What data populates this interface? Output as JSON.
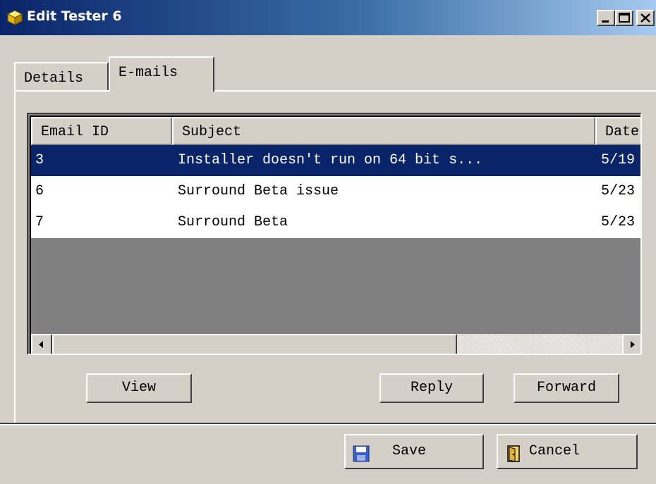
{
  "window": {
    "title": "Edit Tester 6",
    "icon": "yellow-cube-icon",
    "controls": [
      "minimize-icon",
      "maximize-icon",
      "close-icon"
    ]
  },
  "tabs": [
    {
      "label": "Details",
      "active": false
    },
    {
      "label": "E-mails",
      "active": true
    }
  ],
  "email_list": {
    "columns": [
      "Email ID",
      "Subject",
      "Date"
    ],
    "rows": [
      {
        "id": "3",
        "subject": "Installer doesn't run on 64 bit s...",
        "date": "5/19",
        "selected": true
      },
      {
        "id": "6",
        "subject": "Surround Beta issue",
        "date": "5/23",
        "selected": false
      },
      {
        "id": "7",
        "subject": "Surround Beta",
        "date": "5/23",
        "selected": false
      }
    ],
    "horizontal_scroll": {
      "thumb_fraction": 0.71,
      "position": 0
    }
  },
  "actions": {
    "view_label": "View",
    "reply_label": "Reply",
    "forward_label": "Forward"
  },
  "footer": {
    "save_label": "Save",
    "save_icon": "floppy-disk-icon",
    "cancel_label": "Cancel",
    "cancel_icon": "door-exit-icon"
  },
  "colors": {
    "selection": "#0a246a",
    "face": "#d4d0c8",
    "list_empty_area": "#808080"
  }
}
